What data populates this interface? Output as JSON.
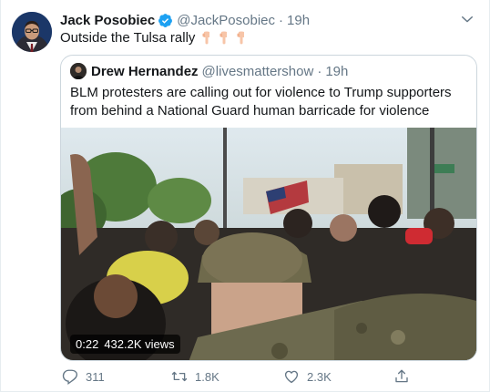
{
  "colors": {
    "accent": "#1da1f2",
    "text_primary": "#14171a",
    "text_secondary": "#657786",
    "border": "#ccd6dd"
  },
  "tweet": {
    "author_name": "Jack Posobiec",
    "author_handle": "@JackPosobiec",
    "separator": "·",
    "time": "19h",
    "text": "Outside the Tulsa rally",
    "emojis": [
      "backhand-index-pointing-down",
      "backhand-index-pointing-down",
      "backhand-index-pointing-down"
    ],
    "verified_icon": "verified-badge-icon",
    "menu_icon": "chevron-down-icon"
  },
  "quoted_tweet": {
    "author_name": "Drew Hernandez",
    "author_handle": "@livesmattershow",
    "separator": "·",
    "time": "19h",
    "text": "BLM protesters are calling out for violence to Trump supporters from behind a National Guard human barricade for violence",
    "video": {
      "duration": "0:22",
      "views": "432.2K views"
    }
  },
  "actions": {
    "reply": {
      "icon": "reply-icon",
      "count": "311"
    },
    "retweet": {
      "icon": "retweet-icon",
      "count": "1.8K"
    },
    "like": {
      "icon": "heart-icon",
      "count": "2.3K"
    },
    "share": {
      "icon": "share-icon"
    }
  }
}
